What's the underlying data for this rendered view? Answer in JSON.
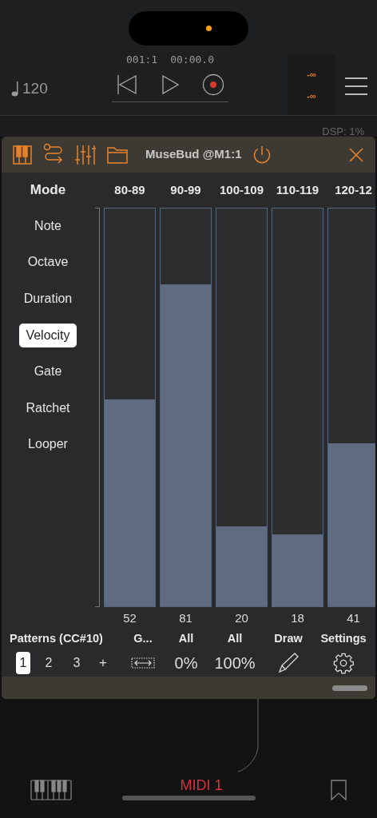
{
  "transport": {
    "tempo": "120",
    "position": "001:1",
    "time": "00:00.0",
    "meters": [
      "-∞",
      "-∞"
    ],
    "dsp": "DSP: 1%"
  },
  "plugin": {
    "title": "MuseBud @M1:1",
    "mode_header": "Mode",
    "modes": [
      {
        "label": "Note",
        "selected": false
      },
      {
        "label": "Octave",
        "selected": false
      },
      {
        "label": "Duration",
        "selected": false
      },
      {
        "label": "Velocity",
        "selected": true
      },
      {
        "label": "Gate",
        "selected": false
      },
      {
        "label": "Ratchet",
        "selected": false
      },
      {
        "label": "Looper",
        "selected": false
      }
    ],
    "columns": [
      {
        "range": "80-89",
        "level": 0.52,
        "value": "52"
      },
      {
        "range": "90-99",
        "level": 0.81,
        "value": "81"
      },
      {
        "range": "100-109",
        "level": 0.2,
        "value": "20"
      },
      {
        "range": "110-119",
        "level": 0.18,
        "value": "18"
      },
      {
        "range": "120-12",
        "level": 0.41,
        "value": "41"
      }
    ],
    "patterns_label": "Patterns (CC#10)",
    "patterns": [
      {
        "label": "1",
        "selected": true
      },
      {
        "label": "2",
        "selected": false
      },
      {
        "label": "3",
        "selected": false
      }
    ],
    "add_pattern": "+",
    "tools": [
      {
        "label": "G...",
        "kind": "stretch"
      },
      {
        "label": "All",
        "kind": "text",
        "control": "0%"
      },
      {
        "label": "All",
        "kind": "text",
        "control": "100%"
      },
      {
        "label": "Draw",
        "kind": "pencil"
      },
      {
        "label": "Settings",
        "kind": "gear"
      }
    ]
  },
  "footer": {
    "track": "MIDI 1"
  }
}
